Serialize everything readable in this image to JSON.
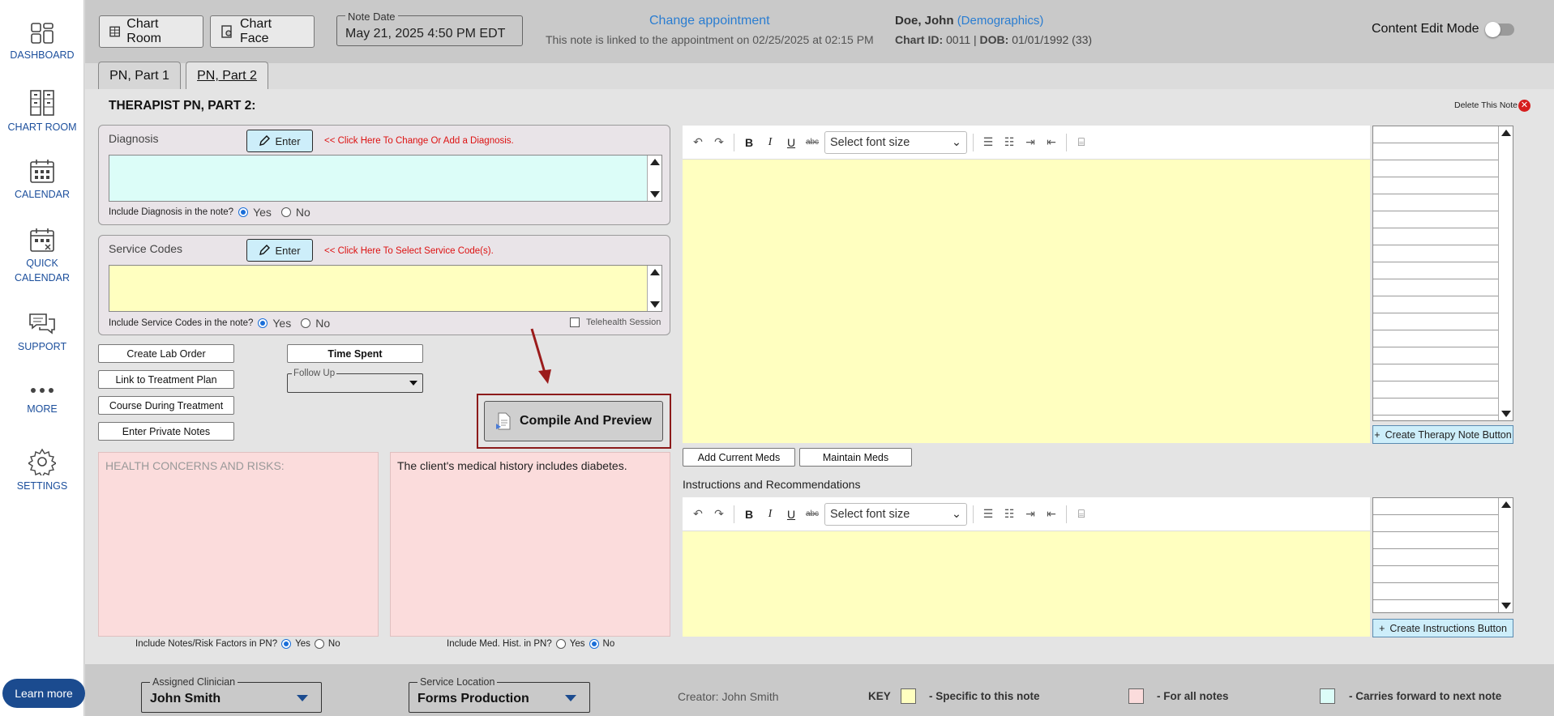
{
  "sidebar": {
    "items": [
      {
        "label": "DASHBOARD",
        "icon": "dashboard-icon"
      },
      {
        "label": "CHART ROOM",
        "icon": "cabinet-icon"
      },
      {
        "label": "CALENDAR",
        "icon": "calendar-icon"
      },
      {
        "label_line1": "QUICK",
        "label_line2": "CALENDAR",
        "icon": "quick-calendar-icon"
      },
      {
        "label": "SUPPORT",
        "icon": "chat-icon"
      },
      {
        "label": "MORE",
        "icon": "more-dots-icon"
      },
      {
        "label": "SETTINGS",
        "icon": "gear-icon"
      }
    ],
    "learn_more": "Learn more"
  },
  "header": {
    "chart_room_btn": "Chart Room",
    "chart_face_btn": "Chart Face",
    "note_date_label": "Note Date",
    "note_date_value": "May 21, 2025 4:50 PM EDT",
    "change_appointment": "Change appointment",
    "appointment_text": "This note is linked to the appointment on 02/25/2025 at 02:15 PM",
    "patient_name": "Doe, John",
    "demographics_link": "(Demographics)",
    "chart_id_label": "Chart ID:",
    "chart_id": "0011",
    "dob_sep": "|",
    "dob_label": "DOB:",
    "dob": "01/01/1992 (33)",
    "content_edit_mode": "Content Edit Mode"
  },
  "tabs": [
    {
      "label": "PN, Part 1"
    },
    {
      "label": "PN, Part 2"
    }
  ],
  "section_title": "THERAPIST PN, PART 2:",
  "delete_note": "Delete This Note",
  "diagnosis": {
    "title": "Diagnosis",
    "enter": "Enter",
    "hint": "<< Click Here To Change Or Add a Diagnosis.",
    "include_label": "Include Diagnosis in the note?",
    "yes": "Yes",
    "no": "No",
    "selected": "Yes"
  },
  "service_codes": {
    "title": "Service Codes",
    "enter": "Enter",
    "hint": "<< Click Here To Select Service Code(s).",
    "include_label": "Include Service Codes in the note?",
    "yes": "Yes",
    "no": "No",
    "selected": "Yes",
    "telehealth": "Telehealth Session"
  },
  "buttons": {
    "create_lab_order": "Create Lab Order",
    "link_treatment_plan": "Link to Treatment Plan",
    "course_during_treatment": "Course During Treatment",
    "enter_private_notes": "Enter Private Notes",
    "time_spent": "Time Spent",
    "follow_up": "Follow Up",
    "compile_preview": "Compile And Preview",
    "add_current_meds": "Add Current Meds",
    "maintain_meds": "Maintain Meds",
    "create_therapy_note": "Create Therapy Note Button",
    "create_instructions": "Create Instructions Button"
  },
  "health": {
    "placeholder": "HEALTH CONCERNS AND RISKS:",
    "medical_history": "The client's medical history includes diabetes.",
    "include_risk_label": "Include Notes/Risk Factors in PN?",
    "include_medhist_label": "Include Med. Hist. in PN?",
    "yes": "Yes",
    "no": "No",
    "risk_selected": "Yes",
    "medhist_selected": "No"
  },
  "editor": {
    "font_size_placeholder": "Select font size",
    "bold": "B",
    "italic": "I",
    "underline": "U",
    "strike": "abc"
  },
  "instructions_title": "Instructions and Recommendations",
  "footer": {
    "assigned_clinician_label": "Assigned Clinician",
    "assigned_clinician": "John Smith",
    "service_location_label": "Service Location",
    "service_location": "Forms Production",
    "creator": "Creator: John Smith",
    "key_label": "KEY",
    "key_specific": "- Specific to this note",
    "key_all": "- For all notes",
    "key_forward": "- Carries forward to next note"
  },
  "colors": {
    "yellow": "#ffffc0",
    "pink": "#fbdcdc",
    "cyan": "#dcfdf8",
    "link": "#2a7dd1",
    "hint_red": "#dd1111",
    "arrow": "#9b1b1b",
    "nav_blue": "#1c4f9c"
  }
}
